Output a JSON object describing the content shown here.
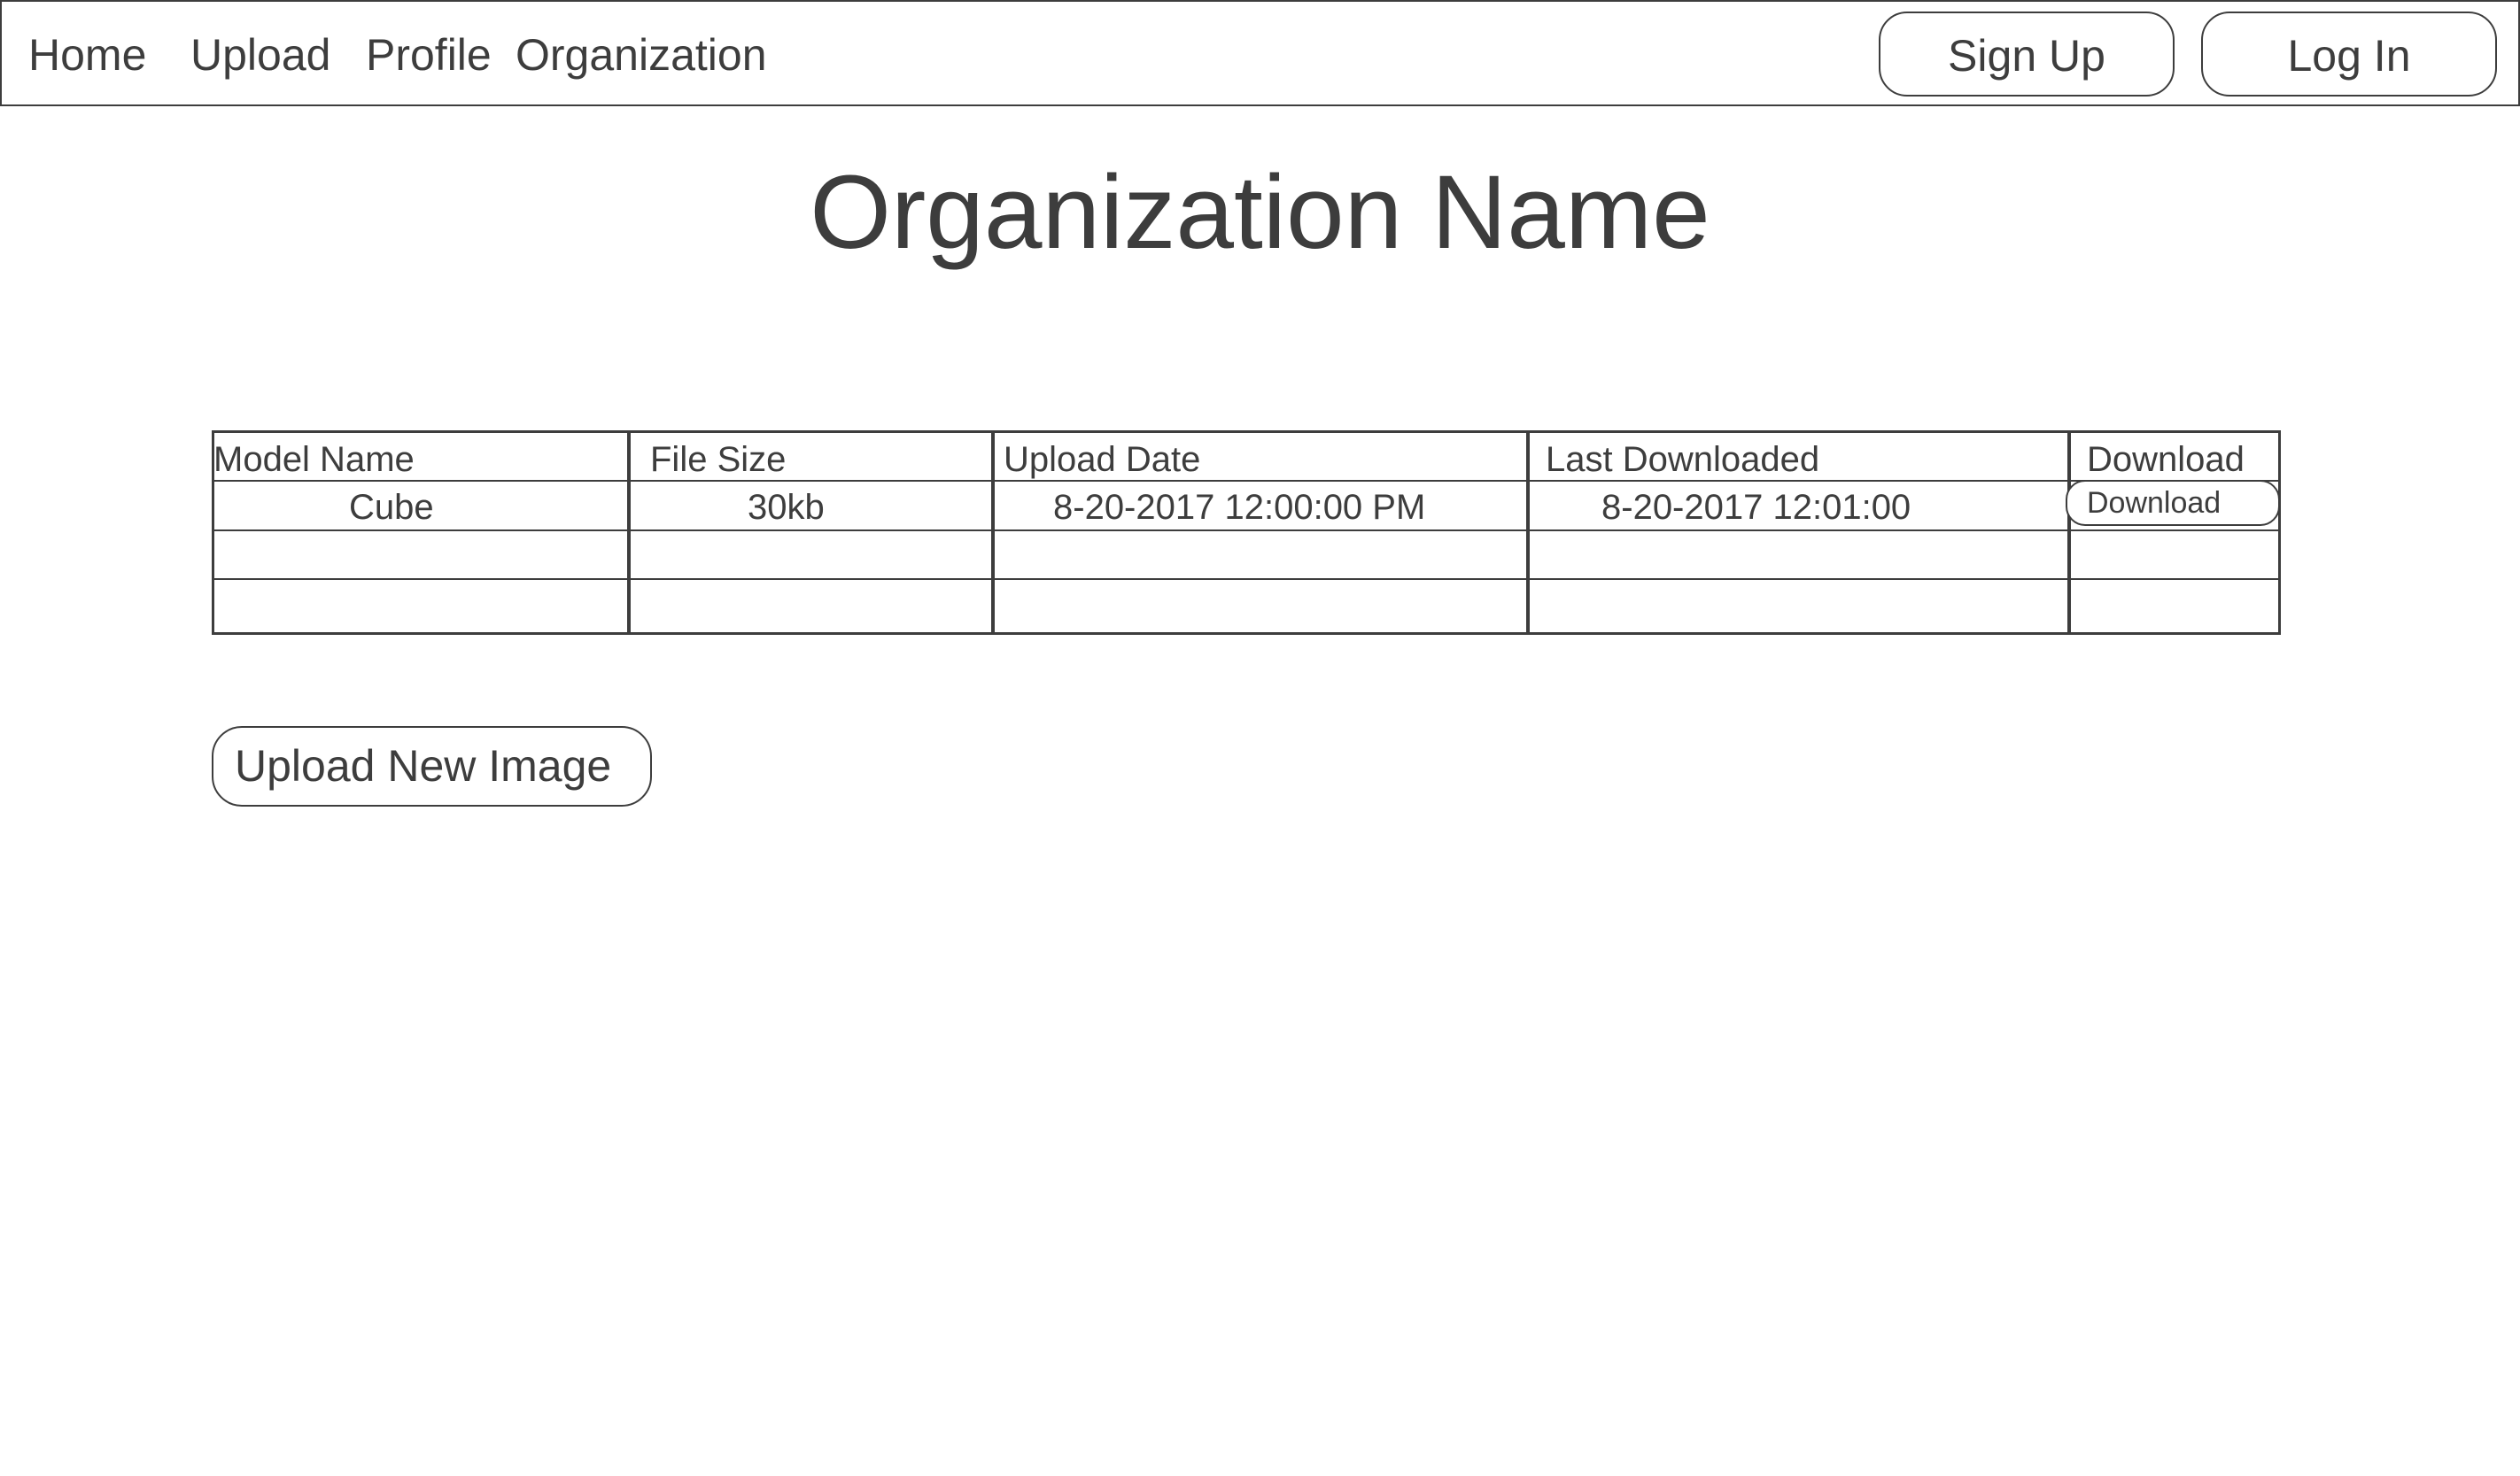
{
  "nav": {
    "home": "Home",
    "upload": "Upload",
    "profile": "Profile",
    "organization": "Organization",
    "sign_up": "Sign Up",
    "log_in": "Log In"
  },
  "page": {
    "title": "Organization Name"
  },
  "table": {
    "headers": [
      "Model Name",
      "File Size",
      "Upload Date",
      "Last Downloaded",
      "Download"
    ],
    "rows": [
      {
        "model_name": "Cube",
        "file_size": "30kb",
        "upload_date": "8-20-2017 12:00:00 PM",
        "last_downloaded": "8-20-2017 12:01:00",
        "download_label": "Download"
      }
    ]
  },
  "actions": {
    "upload_new_image": "Upload New Image"
  }
}
